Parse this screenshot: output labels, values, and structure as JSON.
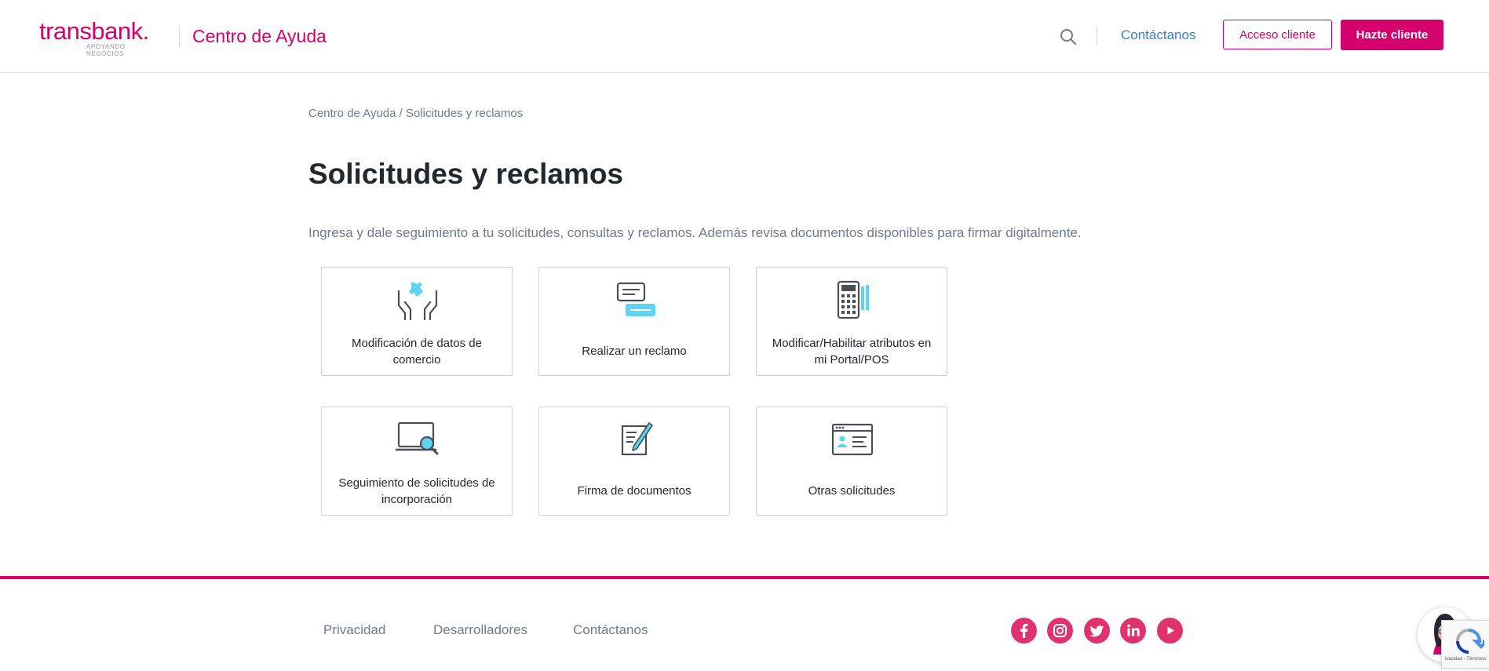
{
  "header": {
    "logo_word": "transbank.",
    "logo_tagline": "APOYANDO NEGOCIOS",
    "site_title": "Centro de Ayuda",
    "search_icon": "search-icon",
    "contact_label": "Contáctanos",
    "login_label": "Acceso cliente",
    "signup_label": "Hazte cliente"
  },
  "breadcrumb": {
    "home": "Centro de Ayuda",
    "separator": " / ",
    "current": "Solicitudes y reclamos"
  },
  "main": {
    "title": "Solicitudes y reclamos",
    "subtitle": "Ingresa y dale seguimiento a tu solicitudes, consultas y reclamos. Además revisa documentos disponibles para firmar digitalmente.",
    "cards": [
      {
        "label": "Modificación de datos de comercio",
        "icon": "hands-puzzle-icon"
      },
      {
        "label": "Realizar un reclamo",
        "icon": "message-bubbles-icon"
      },
      {
        "label": "Modificar/Habilitar atributos en mi Portal/POS",
        "icon": "pos-terminal-icon"
      },
      {
        "label": "Seguimiento de solicitudes de incorporación",
        "icon": "laptop-search-icon"
      },
      {
        "label": "Firma de documentos",
        "icon": "document-sign-icon"
      },
      {
        "label": "Otras solicitudes",
        "icon": "browser-profile-icon"
      }
    ]
  },
  "footer": {
    "links": [
      "Privacidad",
      "Desarrolladores",
      "Contáctanos"
    ],
    "social": [
      "facebook-icon",
      "instagram-icon",
      "twitter-icon",
      "linkedin-icon",
      "youtube-icon"
    ],
    "recaptcha_text": "ivacidad - Términos"
  },
  "colors": {
    "brand": "#d5006d",
    "link": "#2a7fd4",
    "muted_text": "#707a8c",
    "icon_accent": "#5fd3f0",
    "icon_dark": "#4a4f55"
  }
}
